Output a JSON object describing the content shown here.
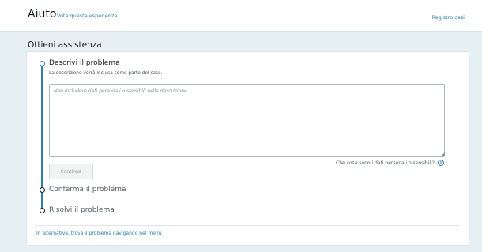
{
  "header": {
    "title": "Aiuto",
    "rate_link": "Vota questa esperienza",
    "cases_link": "Registro casi"
  },
  "main": {
    "section_title": "Ottieni assistenza",
    "steps": [
      {
        "title": "Descrivi il problema",
        "description": "La descrizione verrà inclusa come parte del caso.",
        "active": true
      },
      {
        "title": "Conferma il problema",
        "active": false
      },
      {
        "title": "Risolvi il problema",
        "active": false
      }
    ],
    "description_input": {
      "placeholder": "Non includere dati personali o sensibili nella descrizione.",
      "value": ""
    },
    "help_link": "Che cosa sono i dati personali o sensibili?",
    "info_icon": "info-icon",
    "continue_label": "Continua",
    "alternative_link": "In alternativa, trova il problema navigando nel menu"
  },
  "colors": {
    "accent": "#2f7fae",
    "link": "#2a7ea8",
    "background": "#e6f0f2"
  }
}
